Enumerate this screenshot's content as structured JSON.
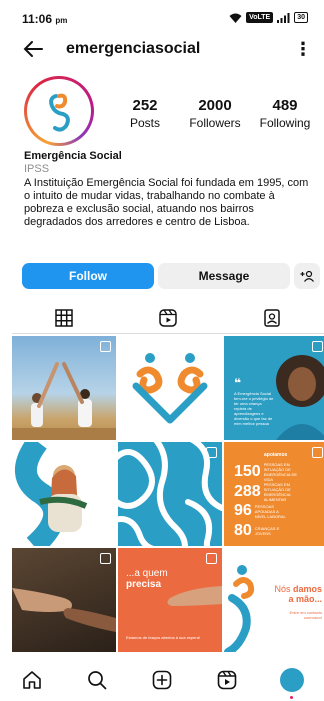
{
  "status": {
    "time": "11:06",
    "ampm": "pm",
    "volte": "VoLTE",
    "battery": "30"
  },
  "header": {
    "username": "emergenciasocial"
  },
  "profile": {
    "stats": [
      {
        "value": "252",
        "label": "Posts"
      },
      {
        "value": "2000",
        "label": "Followers"
      },
      {
        "value": "489",
        "label": "Following"
      }
    ],
    "name": "Emergência Social",
    "category": "IPSS",
    "bio": "A Instituição Emergência Social foi fundada em 1995, com o intuito de mudar vidas, trabalhando no combate à pobreza e exclusão social, atuando nos bairros degradados dos arredores e centro de Lisboa."
  },
  "actions": {
    "follow": "Follow",
    "message": "Message"
  },
  "posts": {
    "p3_quote": "A Emergência Social tem-me o privilégio de ter uma criança repleta de aprendizagens e diversão o que faz de mim melhor pessoa",
    "p6_stats": [
      {
        "num": "150",
        "label": "PESSOAS EM SITUAÇÃO DE EMERGÊNCIA DE VIDA"
      },
      {
        "num": "288",
        "label": "PESSOAS EM SITUAÇÃO DE EMERGÊNCIA ALIMENTAR"
      },
      {
        "num": "96",
        "label": "PESSOAS APOIADAS A NÍVEL LABORAL"
      },
      {
        "num": "80",
        "label": "CRIANÇAS E JOVENS"
      }
    ],
    "p6_badge": "apoiamos",
    "p8_title_1": "...a quem",
    "p8_title_2": "precisa",
    "p8_foot": "Estamos de braços abertos à sua espera!",
    "p9_title_1": "Nós",
    "p9_title_2": "damos",
    "p9_title_3": "a mão...",
    "p9_sub": "Entre em contacto connosco!"
  },
  "colors": {
    "brand_orange": "#f08a2e",
    "brand_blue": "#2b9ec6",
    "follow_blue": "#1f95f0"
  }
}
